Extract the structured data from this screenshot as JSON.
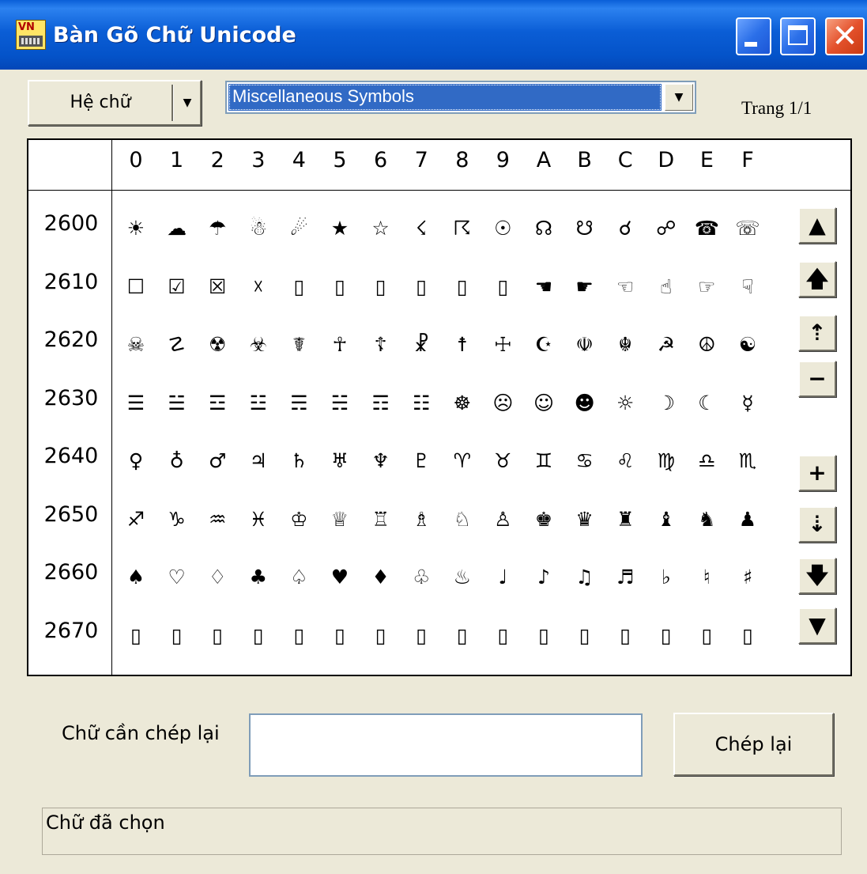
{
  "window": {
    "title": "Bàn Gõ Chữ Unicode",
    "close_glyph": "✕"
  },
  "toolbar": {
    "script_button_label": "Hệ chữ",
    "dropdown_arrow": "▼",
    "block_selected": "Miscellaneous Symbols",
    "page_label": "Trang 1/1"
  },
  "grid": {
    "columns": [
      "0",
      "1",
      "2",
      "3",
      "4",
      "5",
      "6",
      "7",
      "8",
      "9",
      "A",
      "B",
      "C",
      "D",
      "E",
      "F"
    ],
    "rows": [
      {
        "label": "2600",
        "cells": [
          "☀",
          "☁",
          "☂",
          "☃",
          "☄",
          "★",
          "☆",
          "☇",
          "☈",
          "☉",
          "☊",
          "☋",
          "☌",
          "☍",
          "☎",
          "☏"
        ]
      },
      {
        "label": "2610",
        "cells": [
          "☐",
          "☑",
          "☒",
          "☓",
          "▯",
          "▯",
          "▯",
          "▯",
          "▯",
          "▯",
          "☚",
          "☛",
          "☜",
          "☝",
          "☞",
          "☟"
        ]
      },
      {
        "label": "2620",
        "cells": [
          "☠",
          "☡",
          "☢",
          "☣",
          "☤",
          "☥",
          "☦",
          "☧",
          "☨",
          "☩",
          "☪",
          "☫",
          "☬",
          "☭",
          "☮",
          "☯"
        ]
      },
      {
        "label": "2630",
        "cells": [
          "☰",
          "☱",
          "☲",
          "☳",
          "☴",
          "☵",
          "☶",
          "☷",
          "☸",
          "☹",
          "☺",
          "☻",
          "☼",
          "☽",
          "☾",
          "☿"
        ]
      },
      {
        "label": "2640",
        "cells": [
          "♀",
          "♁",
          "♂",
          "♃",
          "♄",
          "♅",
          "♆",
          "♇",
          "♈",
          "♉",
          "♊",
          "♋",
          "♌",
          "♍",
          "♎",
          "♏"
        ]
      },
      {
        "label": "2650",
        "cells": [
          "♐",
          "♑",
          "♒",
          "♓",
          "♔",
          "♕",
          "♖",
          "♗",
          "♘",
          "♙",
          "♚",
          "♛",
          "♜",
          "♝",
          "♞",
          "♟"
        ]
      },
      {
        "label": "2660",
        "cells": [
          "♠",
          "♡",
          "♢",
          "♣",
          "♤",
          "♥",
          "♦",
          "♧",
          "♨",
          "♩",
          "♪",
          "♫",
          "♬",
          "♭",
          "♮",
          "♯"
        ]
      },
      {
        "label": "2670",
        "cells": [
          "▯",
          "▯",
          "▯",
          "▯",
          "▯",
          "▯",
          "▯",
          "▯",
          "▯",
          "▯",
          "▯",
          "▯",
          "▯",
          "▯",
          "▯",
          "▯"
        ]
      }
    ]
  },
  "nav": [
    {
      "name": "nav-first-button",
      "glyph": "▲",
      "icon": "arrow-up-bold-icon"
    },
    {
      "name": "nav-page-up-button",
      "glyph": "🡅",
      "icon": "arrow-up-icon"
    },
    {
      "name": "nav-line-up-button",
      "glyph": "⇡",
      "icon": "arrow-up-thin-icon"
    },
    {
      "name": "nav-zoom-out-button",
      "glyph": "−",
      "icon": "minus-icon"
    },
    {
      "name": "nav-zoom-in-button",
      "glyph": "+",
      "icon": "plus-icon"
    },
    {
      "name": "nav-line-down-button",
      "glyph": "⇣",
      "icon": "arrow-down-thin-icon"
    },
    {
      "name": "nav-page-down-button",
      "glyph": "🡇",
      "icon": "arrow-down-icon"
    },
    {
      "name": "nav-last-button",
      "glyph": "▼",
      "icon": "arrow-down-bold-icon"
    }
  ],
  "copy": {
    "label": "Chữ cần chép lại",
    "input_value": "",
    "button_label": "Chép lại"
  },
  "status": {
    "chosen_label": "Chữ đã chọn"
  }
}
